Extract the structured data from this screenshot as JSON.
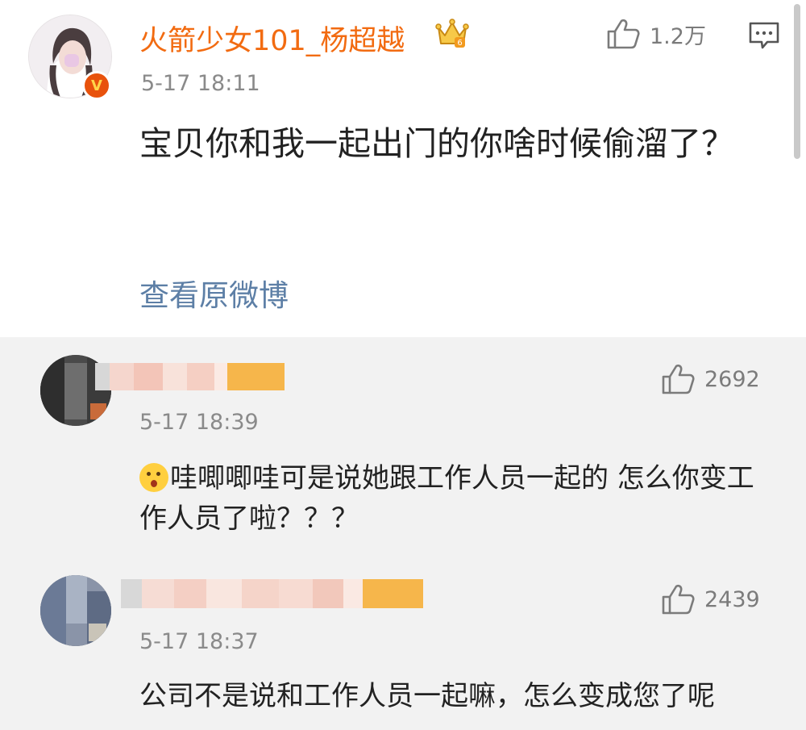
{
  "post": {
    "username": "火箭少女101_杨超越",
    "verified_badge": "V",
    "time": "5-17 18:11",
    "likes": "1.2万",
    "text": "宝贝你和我一起出门的你啥时候偷溜了？",
    "view_original": "查看原微博"
  },
  "comments": [
    {
      "time": "5-17 18:39",
      "likes": "2692",
      "text": "哇唧唧哇可是说她跟工作人员一起的 怎么你变工作人员了啦？？？"
    },
    {
      "time": "5-17 18:37",
      "likes": "2439",
      "text": "公司不是说和工作人员一起嘛，怎么变成您了呢"
    }
  ],
  "icons": {
    "like": "thumbs-up-icon",
    "comment": "message-icon",
    "crown": "crown-icon"
  },
  "colors": {
    "username": "#f26b11",
    "link": "#5d7fa6",
    "meta": "#8a8a8a",
    "comment_bg": "#f2f2f2"
  }
}
